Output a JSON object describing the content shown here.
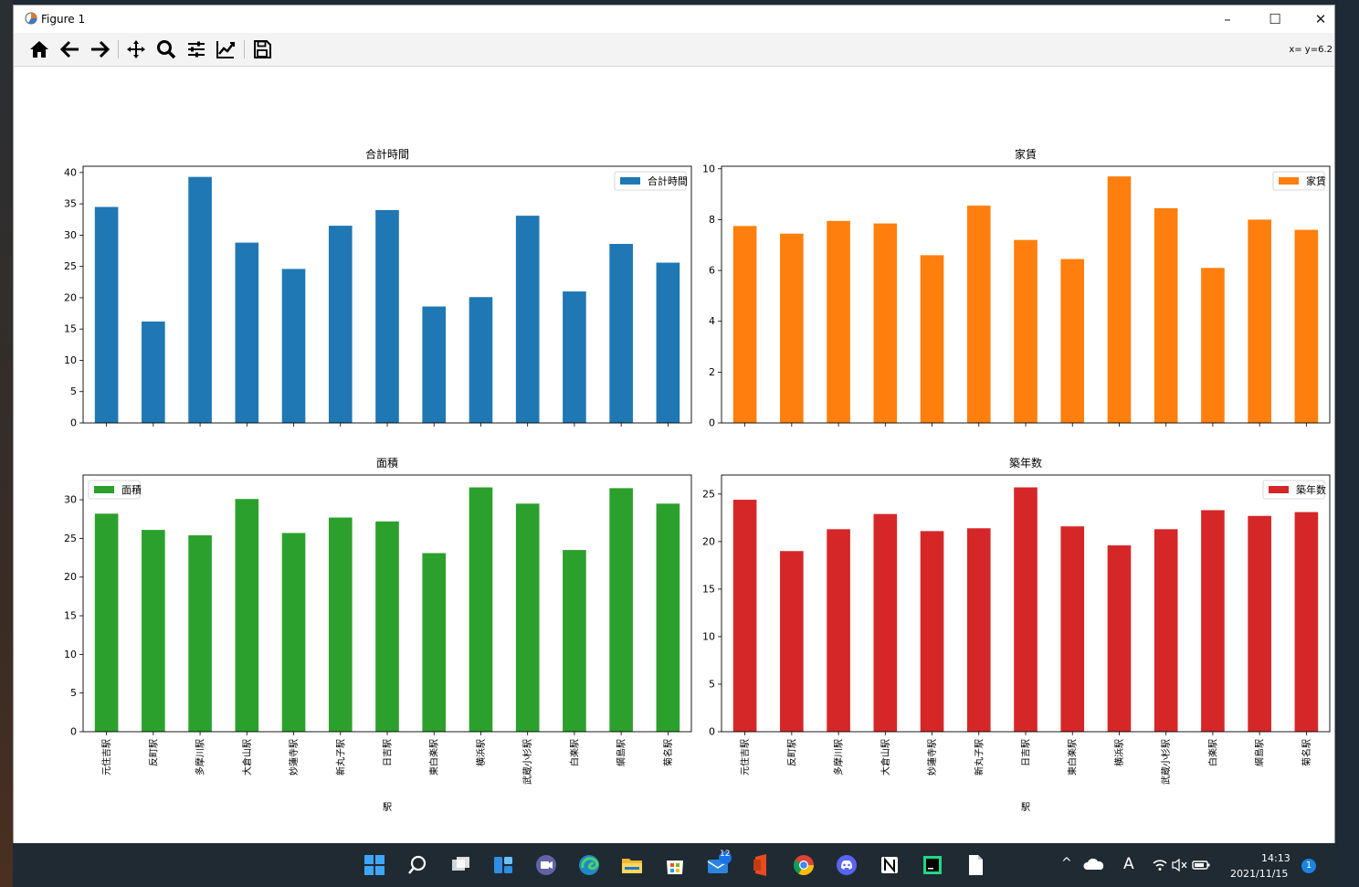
{
  "window": {
    "title": "Figure 1",
    "minimize": "–",
    "maximize": "☐",
    "close": "✕"
  },
  "toolbar": {
    "items": [
      "home-icon",
      "back-icon",
      "forward-icon",
      "pan-icon",
      "zoom-icon",
      "configure-subplots-icon",
      "edit-axis-icon",
      "save-icon"
    ],
    "coords": "x= y=6.2"
  },
  "colors": {
    "blue": "#1f77b4",
    "orange": "#ff7f0e",
    "green": "#2ca02c",
    "red": "#d62728"
  },
  "chart_data": [
    {
      "type": "bar",
      "title": "合計時間",
      "categories": [
        "元住吉駅",
        "反町駅",
        "多摩川駅",
        "大倉山駅",
        "妙蓮寺駅",
        "新丸子駅",
        "日吉駅",
        "東白楽駅",
        "横浜駅",
        "武蔵小杉駅",
        "白楽駅",
        "綱島駅",
        "菊名駅"
      ],
      "series": [
        {
          "name": "合計時間",
          "values": [
            34.5,
            16.2,
            39.3,
            28.8,
            24.6,
            31.5,
            34.0,
            18.6,
            20.1,
            33.1,
            21.0,
            28.6,
            25.6
          ]
        }
      ],
      "ylim": [
        0,
        41
      ],
      "yticks": [
        0,
        5,
        10,
        15,
        20,
        25,
        30,
        35,
        40
      ],
      "xlabel": "",
      "legend": "upper right",
      "color": "#1f77b4"
    },
    {
      "type": "bar",
      "title": "家賃",
      "categories": [
        "元住吉駅",
        "反町駅",
        "多摩川駅",
        "大倉山駅",
        "妙蓮寺駅",
        "新丸子駅",
        "日吉駅",
        "東白楽駅",
        "横浜駅",
        "武蔵小杉駅",
        "白楽駅",
        "綱島駅",
        "菊名駅"
      ],
      "series": [
        {
          "name": "家賃",
          "values": [
            7.75,
            7.45,
            7.95,
            7.85,
            6.6,
            8.55,
            7.2,
            6.45,
            9.7,
            8.45,
            6.1,
            8.0,
            7.6
          ]
        }
      ],
      "ylim": [
        0,
        10.1
      ],
      "yticks": [
        0,
        2,
        4,
        6,
        8,
        10
      ],
      "xlabel": "",
      "legend": "upper right",
      "color": "#ff7f0e"
    },
    {
      "type": "bar",
      "title": "面積",
      "categories": [
        "元住吉駅",
        "反町駅",
        "多摩川駅",
        "大倉山駅",
        "妙蓮寺駅",
        "新丸子駅",
        "日吉駅",
        "東白楽駅",
        "横浜駅",
        "武蔵小杉駅",
        "白楽駅",
        "綱島駅",
        "菊名駅"
      ],
      "series": [
        {
          "name": "面積",
          "values": [
            28.2,
            26.1,
            25.4,
            30.1,
            25.7,
            27.7,
            27.2,
            23.1,
            31.6,
            29.5,
            23.5,
            31.5,
            29.5
          ]
        }
      ],
      "ylim": [
        0,
        33.2
      ],
      "yticks": [
        0,
        5,
        10,
        15,
        20,
        25,
        30
      ],
      "xlabel": "駅",
      "legend": "upper left",
      "color": "#2ca02c"
    },
    {
      "type": "bar",
      "title": "築年数",
      "categories": [
        "元住吉駅",
        "反町駅",
        "多摩川駅",
        "大倉山駅",
        "妙蓮寺駅",
        "新丸子駅",
        "日吉駅",
        "東白楽駅",
        "横浜駅",
        "武蔵小杉駅",
        "白楽駅",
        "綱島駅",
        "菊名駅"
      ],
      "series": [
        {
          "name": "築年数",
          "values": [
            24.4,
            19.0,
            21.3,
            22.9,
            21.1,
            21.4,
            25.7,
            21.6,
            19.6,
            21.3,
            23.3,
            22.7,
            23.1
          ]
        }
      ],
      "ylim": [
        0,
        27.0
      ],
      "yticks": [
        0,
        5,
        10,
        15,
        20,
        25
      ],
      "xlabel": "駅",
      "legend": "upper right",
      "color": "#d62728"
    }
  ],
  "taskbar": {
    "icons": [
      "start-icon",
      "search-icon",
      "task-view-icon",
      "widgets-icon",
      "teams-chat-icon",
      "edge-icon",
      "file-explorer-icon",
      "store-icon",
      "mail-icon",
      "office-icon",
      "chrome-icon",
      "discord-icon",
      "notion-icon",
      "pycharm-icon",
      "file-icon"
    ],
    "mail_badge": "12",
    "time": "14:13",
    "date": "2021/11/15",
    "notification_count": "1",
    "ime": "A",
    "tray_chevron": "^"
  }
}
